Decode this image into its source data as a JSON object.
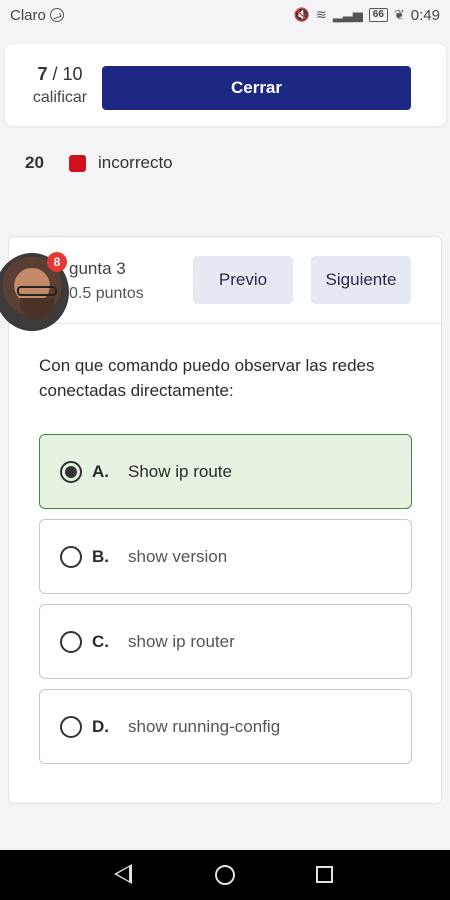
{
  "status_bar": {
    "carrier": "Claro",
    "battery": "66",
    "time": "0:49"
  },
  "score": {
    "current": "7",
    "total": "/ 10",
    "label": "calificar",
    "close_label": "Cerrar"
  },
  "legend": {
    "count": "20",
    "label": "incorrecto",
    "color": "#d0111b"
  },
  "question": {
    "title": "gunta 3",
    "points": "0.5 puntos",
    "prev_label": "Previo",
    "next_label": "Siguiente",
    "text": "Con que comando puedo observar las redes conectadas directamente:",
    "options": [
      {
        "letter": "A.",
        "text": "Show ip route",
        "selected": true
      },
      {
        "letter": "B.",
        "text": "show version",
        "selected": false
      },
      {
        "letter": "C.",
        "text": "show ip router",
        "selected": false
      },
      {
        "letter": "D.",
        "text": "show running-config",
        "selected": false
      }
    ]
  },
  "chat_head": {
    "badge": "8"
  },
  "colors": {
    "primary": "#1d2882",
    "selected_bg": "#e6f3e2",
    "secondary_btn": "#e6e8f4"
  }
}
